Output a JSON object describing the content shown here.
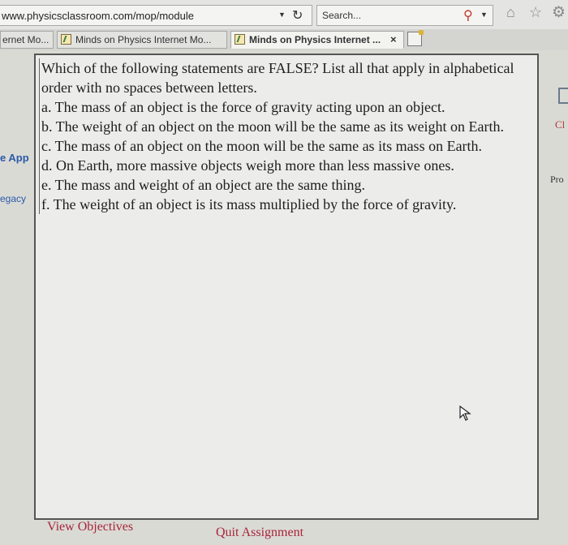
{
  "browser": {
    "url": "www.physicsclassroom.com/mop/module",
    "search_placeholder": "Search..."
  },
  "tabs": [
    {
      "label": "ernet Mo...",
      "active": false
    },
    {
      "label": "Minds on Physics Internet Mo...",
      "active": false
    },
    {
      "label": "Minds on Physics Internet ...",
      "active": true,
      "close": "×"
    }
  ],
  "sidebar_fragments": {
    "left_top": "e App",
    "left_bottom": "egacy",
    "right_top": "Cl",
    "right_bottom": "Pro"
  },
  "question": {
    "prompt": "Which of the following statements are FALSE? List all that apply in alphabetical order with no spaces between letters.",
    "options": [
      "a.  The mass of an object is the force of gravity acting upon an object.",
      "b.  The weight of an object on the moon will be the same as its weight on Earth.",
      "c.  The mass of an object on the moon will be the same as its mass on Earth.",
      "d.  On Earth, more massive objects weigh more than less massive ones.",
      "e.  The mass and weight of an object are the same thing.",
      "f.  The weight of an object is its mass multiplied by the force of gravity."
    ]
  },
  "footer": {
    "view_objectives": "View Objectives",
    "quit_assignment": "Quit Assignment"
  },
  "icons": {
    "refresh": "refresh-icon",
    "search": "search-icon",
    "home": "home-icon",
    "favorites": "star-icon",
    "settings": "gear-icon",
    "cursor": "mouse-cursor-icon"
  }
}
